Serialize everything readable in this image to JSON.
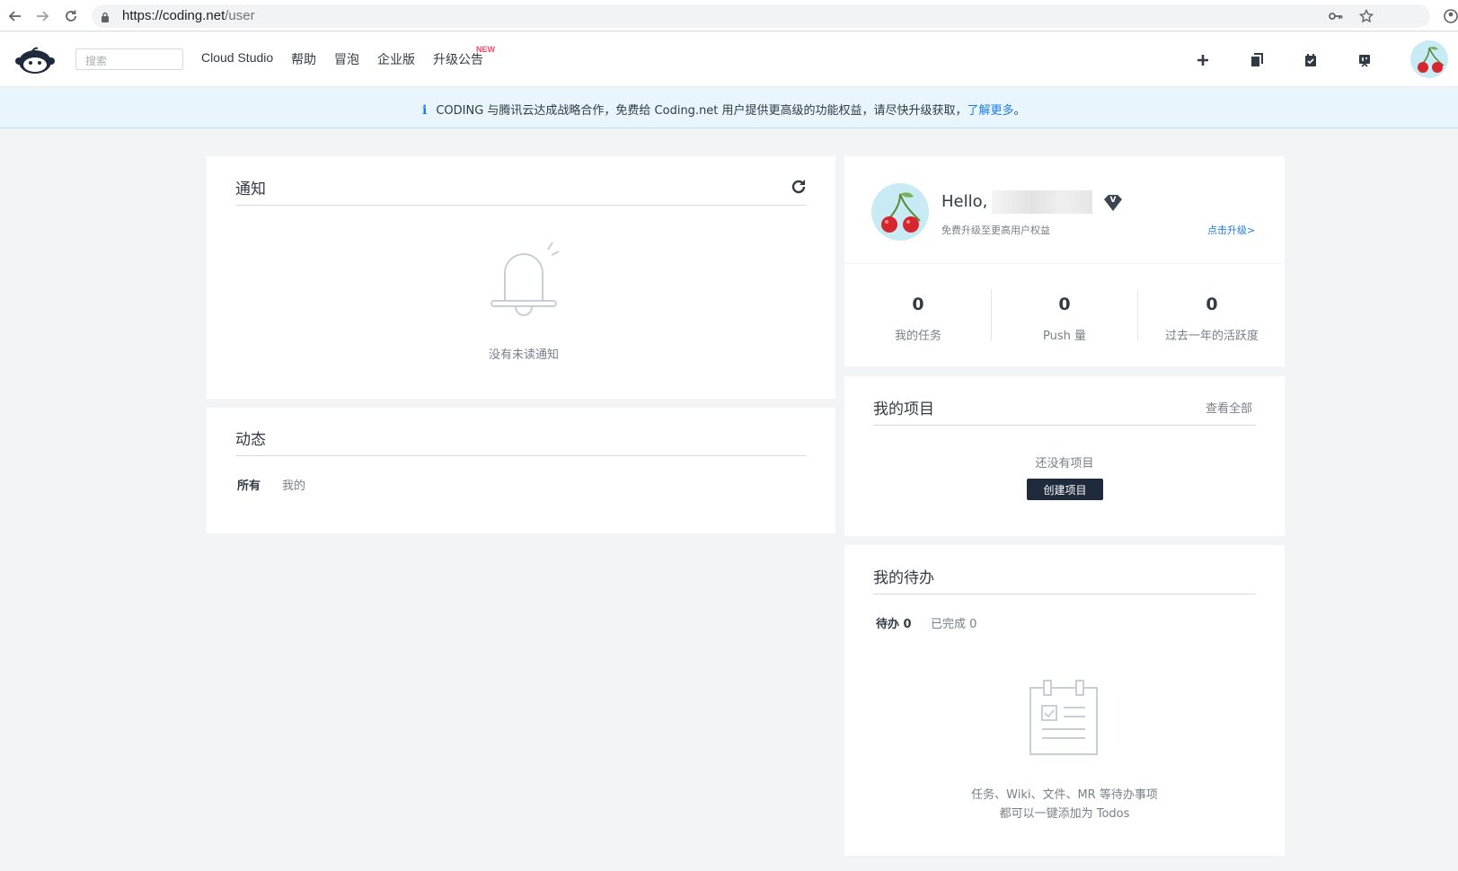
{
  "browser": {
    "url_domain": "https://coding.net",
    "url_path": "/user"
  },
  "header": {
    "search_placeholder": "搜索",
    "nav": [
      {
        "label": "Cloud Studio"
      },
      {
        "label": "帮助"
      },
      {
        "label": "冒泡"
      },
      {
        "label": "企业版"
      },
      {
        "label": "升级公告"
      }
    ],
    "new_badge": "NEW"
  },
  "announcement": {
    "text": "CODING 与腾讯云达成战略合作，免费给 Coding.net 用户提供更高级的功能权益，请尽快升级获取，",
    "link": "了解更多",
    "end": "。"
  },
  "notifications": {
    "title": "通知",
    "empty_text": "没有未读通知"
  },
  "activity": {
    "title": "动态",
    "tabs": [
      {
        "label": "所有",
        "active": true
      },
      {
        "label": "我的",
        "active": false
      }
    ]
  },
  "profile": {
    "greeting": "Hello,",
    "vip_badge": "V",
    "upgrade_hint": "免费升级至更高用户权益",
    "upgrade_link": "点击升级>",
    "stats": [
      {
        "value": "0",
        "label": "我的任务"
      },
      {
        "value": "0",
        "label": "Push 量"
      },
      {
        "value": "0",
        "label": "过去一年的活跃度"
      }
    ]
  },
  "projects": {
    "title": "我的项目",
    "view_all": "查看全部",
    "empty_text": "还没有项目",
    "create_button": "创建项目"
  },
  "todos": {
    "title": "我的待办",
    "tab_pending": "待办 0",
    "tab_done": "已完成 0",
    "empty_line1": "任务、Wiki、文件、MR 等待办事项",
    "empty_line2": "都可以一键添加为 Todos"
  },
  "colors": {
    "accent_link": "#1d7ce0",
    "dark_button": "#1f2b3c",
    "new_badge": "#f5456b",
    "banner_bg": "#e9f5fd"
  }
}
